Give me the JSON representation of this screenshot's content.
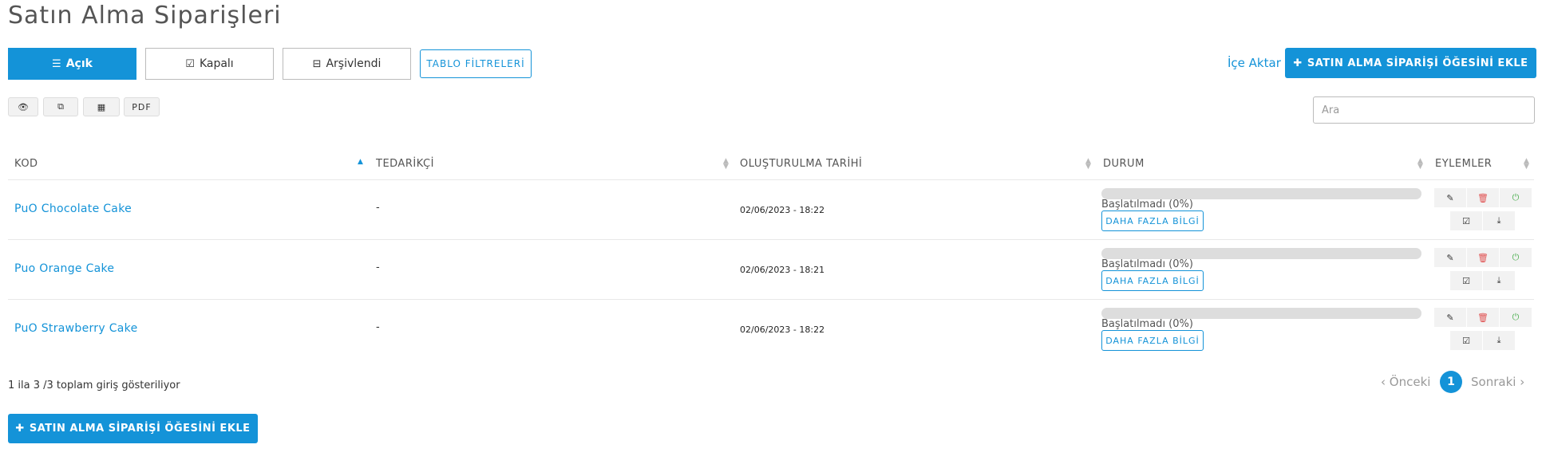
{
  "page": {
    "title": "Satın Alma Siparişleri"
  },
  "tabs": {
    "open": "Açık",
    "closed": "Kapalı",
    "archived": "Arşivlendi"
  },
  "toolbar": {
    "filters": "TABLO FİLTRELERİ",
    "import": "İçe Aktar",
    "add": "SATIN ALMA SİPARİŞİ ÖĞESİNİ EKLE",
    "pdf": "PDF"
  },
  "icons": {
    "open": "list-icon",
    "closed": "check-square-icon",
    "archived": "inbox-icon",
    "view": "eye-icon",
    "copy": "copy-icon",
    "csv": "table-icon",
    "plus": "plus-icon",
    "edit": "edit-icon",
    "delete": "trash-icon",
    "power": "power-icon",
    "complete": "check-square-icon",
    "download": "download-icon"
  },
  "search": {
    "placeholder": "Ara",
    "value": ""
  },
  "table": {
    "columns": [
      "KOD",
      "TEDARİKÇİ",
      "OLUŞTURULMA TARİHİ",
      "DURUM",
      "EYLEMLER"
    ],
    "rows": [
      {
        "code": "PuO Chocolate Cake",
        "supplier": "-",
        "date": "02/06/2023 - 18:22",
        "status": "Başlatılmadı (0%)",
        "progress": 0,
        "more": "DAHA FAZLA BİLGİ"
      },
      {
        "code": "Puo Orange Cake",
        "supplier": "-",
        "date": "02/06/2023 - 18:21",
        "status": "Başlatılmadı (0%)",
        "progress": 0,
        "more": "DAHA FAZLA BİLGİ"
      },
      {
        "code": "PuO Strawberry Cake",
        "supplier": "-",
        "date": "02/06/2023 - 18:22",
        "status": "Başlatılmadı (0%)",
        "progress": 0,
        "more": "DAHA FAZLA BİLGİ"
      }
    ]
  },
  "pagination": {
    "info": "1 ila 3 /3 toplam giriş gösteriliyor",
    "prev": "Önceki",
    "next": "Sonraki",
    "current": "1"
  },
  "colors": {
    "accent": "#1493d8",
    "danger": "#e05252",
    "success": "#4caf50"
  }
}
